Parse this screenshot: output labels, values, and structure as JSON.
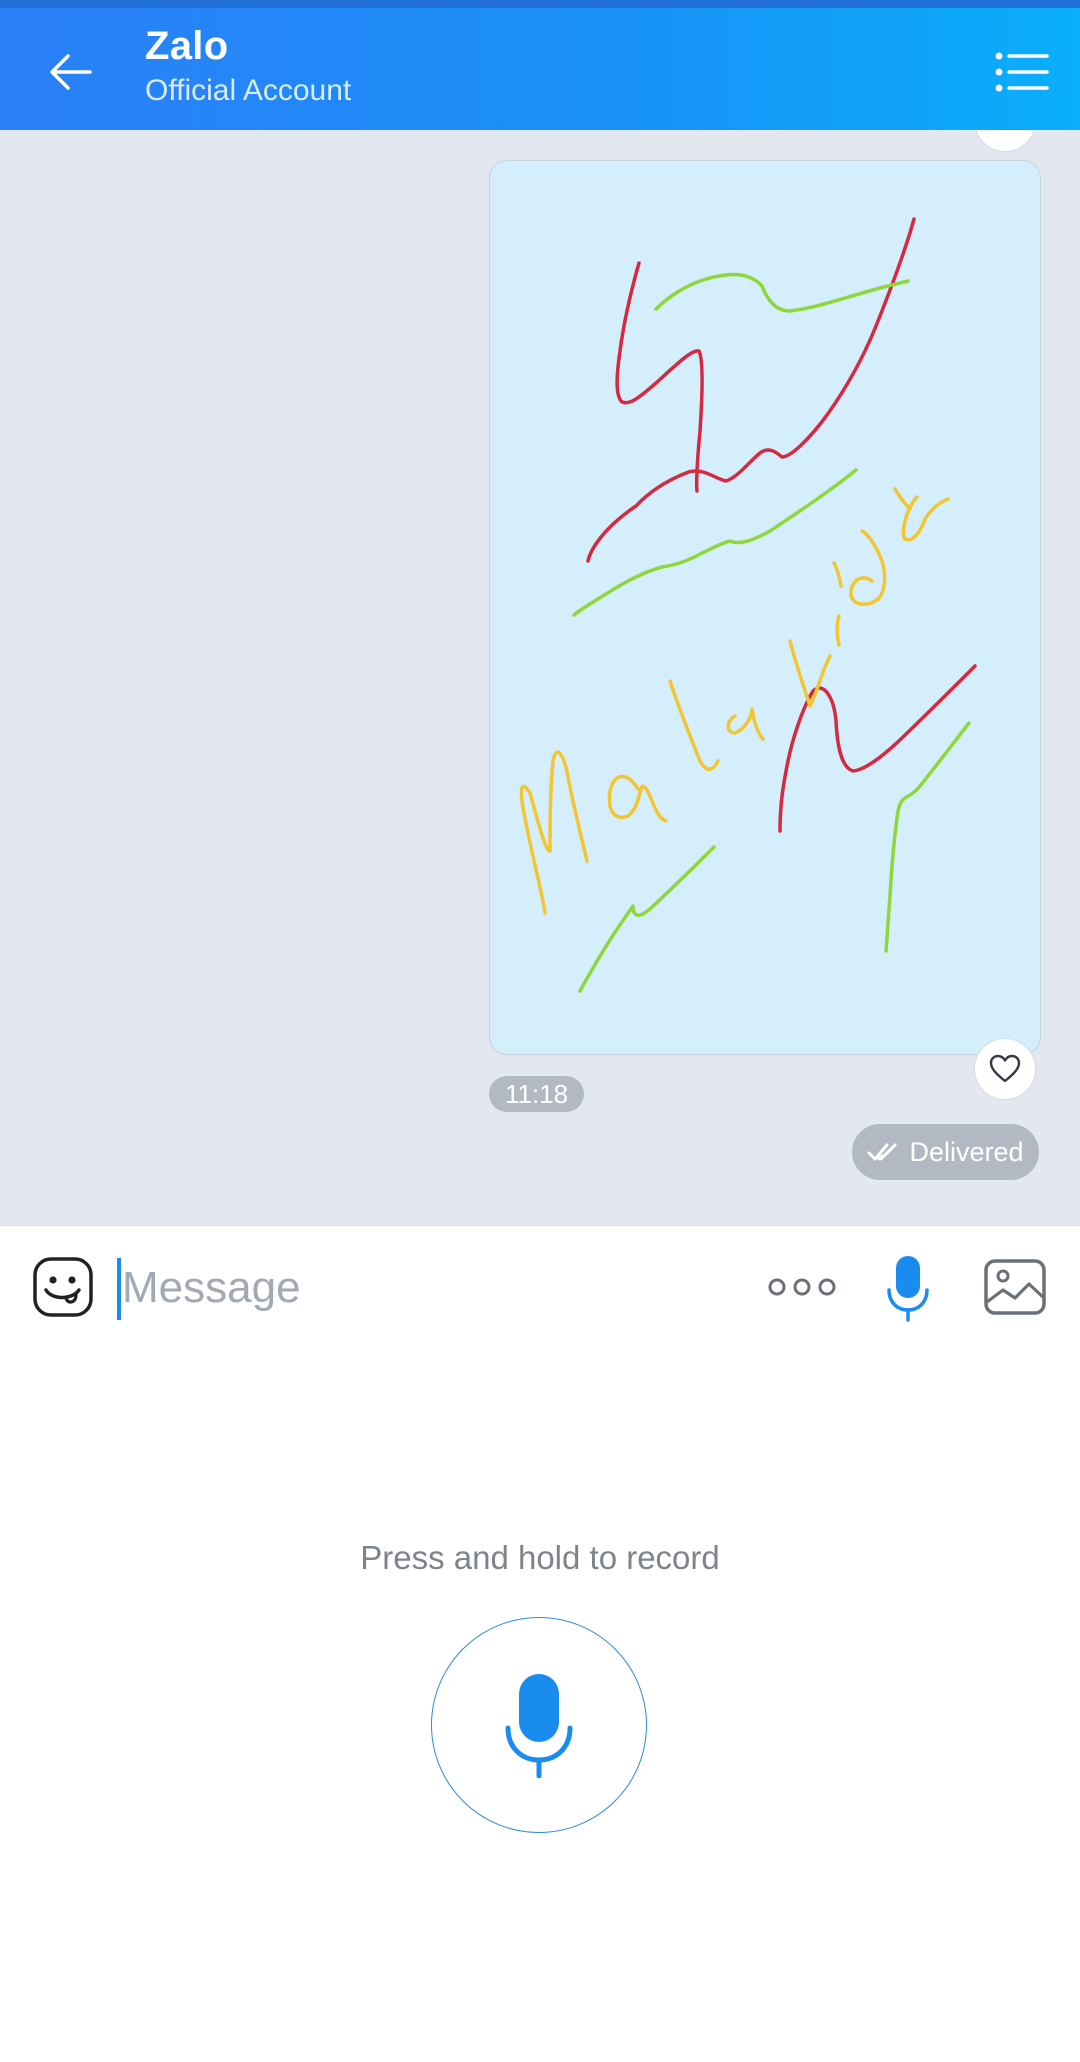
{
  "header": {
    "title": "Zalo",
    "subtitle": "Official Account",
    "back_icon": "arrow-left-icon",
    "menu_icon": "list-menu-icon"
  },
  "message": {
    "type": "drawing",
    "drawing_text": "Malavida",
    "stroke_colors": [
      "#d5293f",
      "#8fd63a",
      "#f2c531"
    ],
    "bubble_color": "#d4eefb",
    "time": "11:18",
    "status": "Delivered",
    "status_icon": "double-check-icon",
    "reaction_icon": "heart-icon"
  },
  "composer": {
    "placeholder": "Message",
    "value": "",
    "emoji_icon": "sticker-face-icon",
    "more_icon": "more-dots-icon",
    "mic_icon": "microphone-icon",
    "gallery_icon": "image-gallery-icon"
  },
  "voice": {
    "hint": "Press and hold to record",
    "record_icon": "microphone-icon"
  },
  "colors": {
    "accent": "#1a8cf0",
    "header_start": "#2b7ff7",
    "header_end": "#0aaef9",
    "chat_bg": "#e3e8f0",
    "pill_bg": "#b3b9c2"
  }
}
